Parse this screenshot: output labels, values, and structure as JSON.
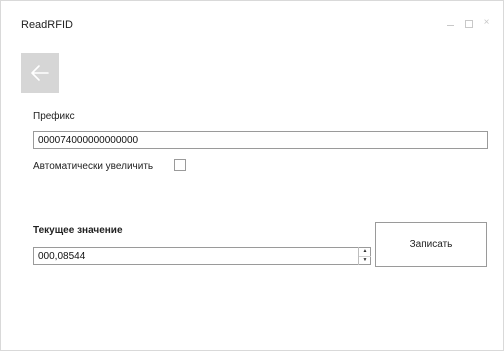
{
  "window": {
    "title": "ReadRFID",
    "controls": [
      "minimize",
      "maximize",
      "close"
    ],
    "close_glyph": "×"
  },
  "toolbar": {
    "back_icon": "back-arrow-icon"
  },
  "form": {
    "prefix_label": "Префикс",
    "prefix_value": "000074000000000000",
    "auto_increment_label": "Автоматически увеличить",
    "auto_increment_checked": false,
    "current_value_label": "Текущее значение",
    "current_value": "000,08544",
    "spin_up_glyph": "▲",
    "spin_down_glyph": "▼",
    "write_button_label": "Записать"
  },
  "colors": {
    "back_button_bg": "#d6d6d6",
    "border": "#9a9a9a",
    "window_controls": "#c8c8c8"
  }
}
